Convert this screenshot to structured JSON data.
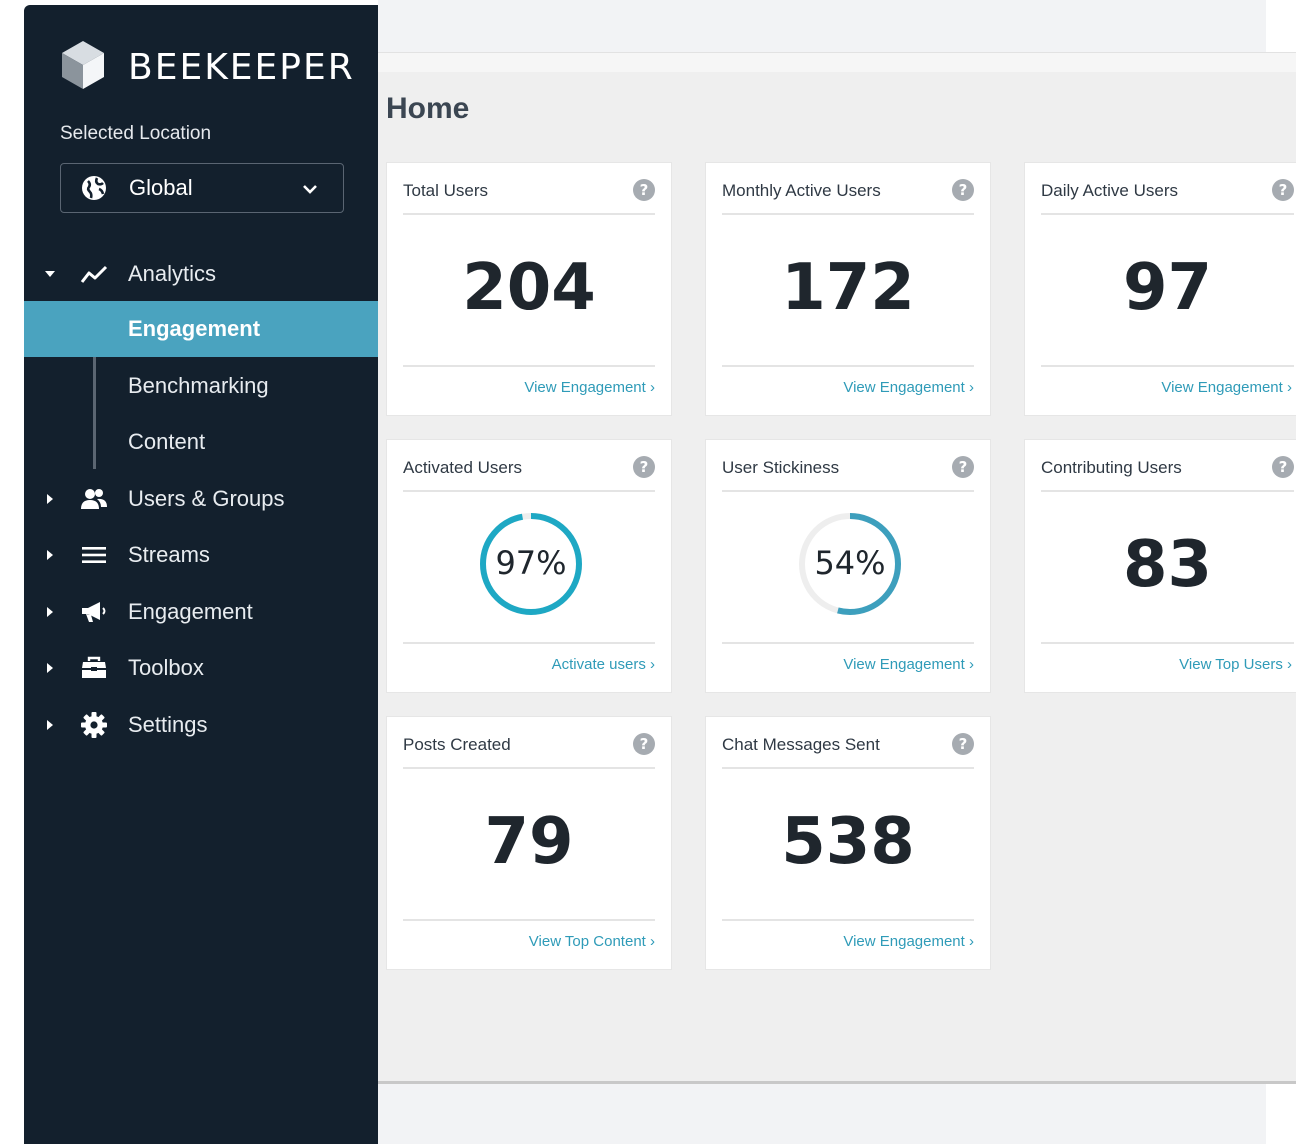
{
  "brand": {
    "name": "BEEKEEPER"
  },
  "sidebar": {
    "location_label": "Selected Location",
    "location_value": "Global",
    "analytics": {
      "label": "Analytics",
      "children": [
        {
          "label": "Engagement",
          "active": true
        },
        {
          "label": "Benchmarking",
          "active": false
        },
        {
          "label": "Content",
          "active": false
        }
      ]
    },
    "items": [
      {
        "label": "Users & Groups",
        "icon": "users-icon"
      },
      {
        "label": "Streams",
        "icon": "streams-icon"
      },
      {
        "label": "Engagement",
        "icon": "megaphone-icon"
      },
      {
        "label": "Toolbox",
        "icon": "toolbox-icon"
      },
      {
        "label": "Settings",
        "icon": "gear-icon"
      }
    ]
  },
  "page": {
    "title": "Home"
  },
  "cards": [
    {
      "title": "Total Users",
      "value": "204",
      "link": "View Engagement"
    },
    {
      "title": "Monthly Active Users",
      "value": "172",
      "link": "View Engagement"
    },
    {
      "title": "Daily Active Users",
      "value": "97",
      "link": "View Engagement"
    },
    {
      "title": "Activated Users",
      "value": "97%",
      "percent": 97,
      "link": "Activate users"
    },
    {
      "title": "User Stickiness",
      "value": "54%",
      "percent": 54,
      "link": "View Engagement"
    },
    {
      "title": "Contributing Users",
      "value": "83",
      "link": "View Top Users"
    },
    {
      "title": "Posts Created",
      "value": "79",
      "link": "View Top Content"
    },
    {
      "title": "Chat Messages Sent",
      "value": "538",
      "link": "View Engagement"
    }
  ],
  "colors": {
    "sidebar_bg": "#13202d",
    "accent": "#4aa3bf",
    "link": "#2f9bb8",
    "gauge_activated": "#1ea8c4",
    "gauge_stickiness": "#3d9fbd"
  }
}
